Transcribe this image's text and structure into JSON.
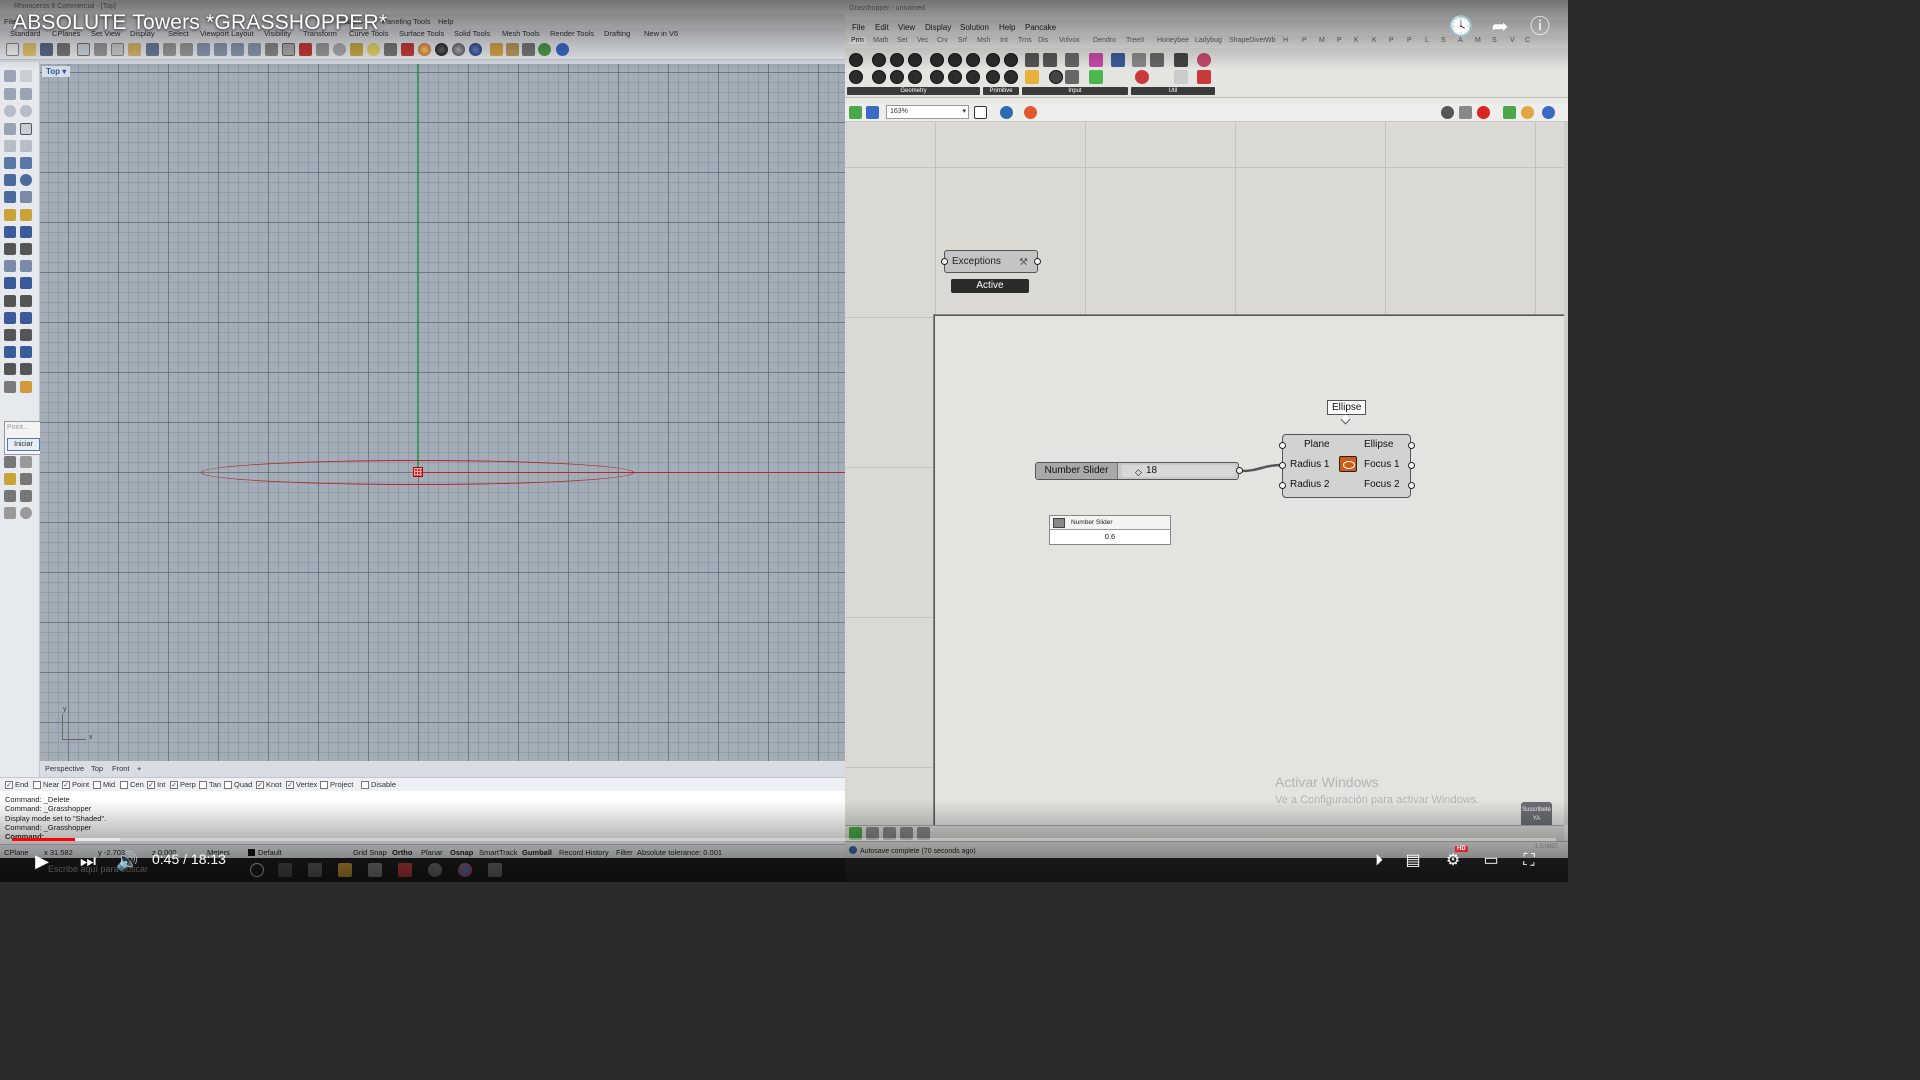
{
  "video": {
    "title": "ABSOLUTE Towers *GRASSHOPPER*",
    "time": "0:45 / 18:13",
    "progress_fraction": 0.041,
    "hd_badge": "HD"
  },
  "rhino": {
    "window_title": "Rhinoceros 6 Commercial - [Top]",
    "menu": [
      "File",
      "Edit",
      "View",
      "Curve",
      "Surface",
      "Solid",
      "Mesh",
      "Dimension",
      "Transform",
      "Tools",
      "Analyze",
      "Render",
      "Panels",
      "Paneling Tools",
      "Help"
    ],
    "toolbar_tabs": [
      "Standard",
      "CPlanes",
      "Set View",
      "Display",
      "Select",
      "Viewport Layout",
      "Visibility",
      "Transform",
      "Curve Tools",
      "Surface Tools",
      "Solid Tools",
      "Mesh Tools",
      "Render Tools",
      "Drafting",
      "New in V6"
    ],
    "viewport_label": "Top",
    "axis_x_label": "x",
    "axis_y_label": "y",
    "view_tabs": [
      "Perspective",
      "Top",
      "Front"
    ],
    "point_popup": {
      "label": "Point...",
      "button": "Iniciar"
    },
    "osnaps": [
      {
        "label": "End",
        "checked": true
      },
      {
        "label": "Near",
        "checked": false
      },
      {
        "label": "Point",
        "checked": true
      },
      {
        "label": "Mid",
        "checked": false
      },
      {
        "label": "Cen",
        "checked": false
      },
      {
        "label": "Int",
        "checked": true
      },
      {
        "label": "Perp",
        "checked": true
      },
      {
        "label": "Tan",
        "checked": false
      },
      {
        "label": "Quad",
        "checked": false
      },
      {
        "label": "Knot",
        "checked": true
      },
      {
        "label": "Vertex",
        "checked": true
      },
      {
        "label": "Project",
        "checked": false
      },
      {
        "label": "Disable",
        "checked": false
      }
    ],
    "command_history": [
      "Command: _Delete",
      "Command: _Grasshopper",
      "Display mode set to \"Shaded\".",
      "Command: _Grasshopper",
      "Command:"
    ],
    "status": {
      "cplane": "CPlane",
      "x": "x 31.582",
      "y": "y -2.703",
      "z": "z 0.000",
      "units": "Meters",
      "layer": "Default",
      "grid_snap": "Grid Snap",
      "ortho": "Ortho",
      "planar": "Planar",
      "osnap": "Osnap",
      "smarttrack": "SmartTrack",
      "gumball": "Gumball",
      "record_history": "Record History",
      "filter": "Filter",
      "tolerance": "Absolute tolerance: 0.001"
    }
  },
  "grasshopper": {
    "window_title": "Grasshopper - unnamed",
    "menu": [
      "File",
      "Edit",
      "View",
      "Display",
      "Solution",
      "Help",
      "Pancake"
    ],
    "tabs": [
      "Prm",
      "Math",
      "Set",
      "Vec",
      "Crv",
      "Srf",
      "Msh",
      "Int",
      "Trns",
      "Dis",
      "Volvox",
      "Dendro",
      "TreeII",
      "Honeybee",
      "Ladybug",
      "ShapeDiver",
      "Wb",
      "H",
      "P",
      "M",
      "P",
      "K",
      "K",
      "P",
      "P",
      "L",
      "S",
      "A",
      "M",
      "S",
      "V",
      "C"
    ],
    "ribbon_groups": [
      "Geometry",
      "Primitive",
      "Input",
      "Util"
    ],
    "zoom": "163%",
    "exceptions_component": {
      "title": "Exceptions",
      "tag": "Active"
    },
    "ellipse_component": {
      "tooltip": "Ellipse",
      "inputs": [
        "Plane",
        "Radius 1",
        "Radius 2"
      ],
      "outputs": [
        "Ellipse",
        "Focus 1",
        "Focus 2"
      ]
    },
    "number_slider": {
      "label": "Number Slider",
      "value": "18"
    },
    "new_slider": {
      "header": "Number Slider",
      "input_value": "0.6"
    },
    "watermark": {
      "line1": "Activar Windows",
      "line2": "Ve a Configuración para activar Windows."
    },
    "subscribe_logo": "Suscríbete YA",
    "status": "Autosave complete (70 seconds ago)",
    "version": "1.0.0007"
  },
  "taskbar": {
    "search_placeholder": "Escribe aquí para buscar"
  }
}
